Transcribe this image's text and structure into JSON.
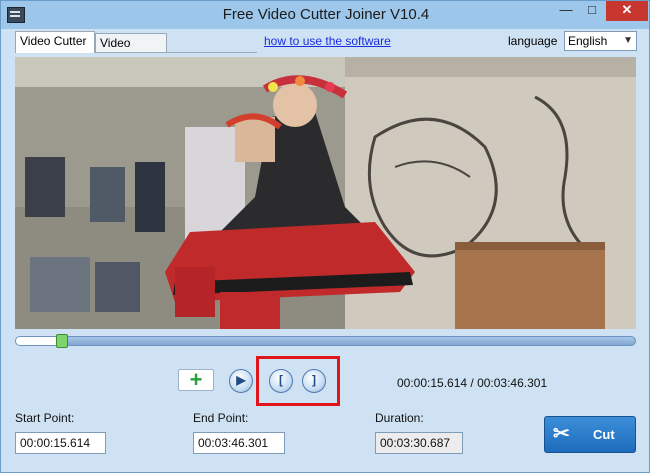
{
  "window": {
    "title": "Free Video Cutter Joiner V10.4",
    "controls": {
      "minimize": "—",
      "maximize": "□",
      "close": "✕"
    }
  },
  "tabs": [
    {
      "label": "Video Cutter",
      "active": true
    },
    {
      "label": "Video Joiner",
      "active": false
    }
  ],
  "help_link": "how to use the software",
  "language": {
    "label": "language",
    "selected": "English"
  },
  "player": {
    "progress": 0.074,
    "time_status": "00:00:15.614 / 00:03:46.301"
  },
  "controls": {
    "add_icon": "plus-icon",
    "play_icon": "play-icon",
    "set_start_glyph": "[",
    "set_end_glyph": "]"
  },
  "fields": {
    "start_label": "Start Point:",
    "start_value": "00:00:15.614",
    "end_label": "End Point:",
    "end_value": "00:03:46.301",
    "duration_label": "Duration:",
    "duration_value": "00:03:30.687"
  },
  "cut_button": {
    "label": "Cut",
    "icon": "scissors-icon"
  },
  "colors": {
    "accent": "#1e6cbd",
    "highlight": "#e0141b",
    "add_green": "#27a136"
  }
}
